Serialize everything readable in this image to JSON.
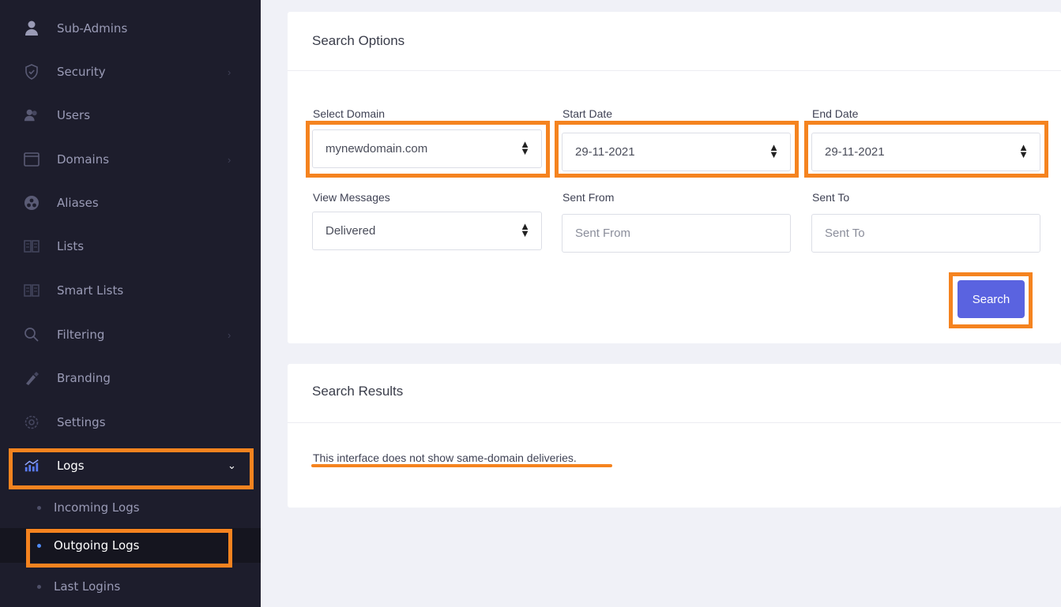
{
  "sidebar": {
    "items": [
      {
        "label": "Sub-Admins",
        "icon": "user-icon"
      },
      {
        "label": "Security",
        "icon": "shield-icon",
        "chevron": "›"
      },
      {
        "label": "Users",
        "icon": "users-icon"
      },
      {
        "label": "Domains",
        "icon": "window-icon",
        "chevron": "›"
      },
      {
        "label": "Aliases",
        "icon": "alias-icon"
      },
      {
        "label": "Lists",
        "icon": "book-icon"
      },
      {
        "label": "Smart Lists",
        "icon": "book-icon"
      },
      {
        "label": "Filtering",
        "icon": "search-icon",
        "chevron": "›"
      },
      {
        "label": "Branding",
        "icon": "brush-icon"
      },
      {
        "label": "Settings",
        "icon": "gear-icon"
      },
      {
        "label": "Logs",
        "icon": "chart-icon",
        "chevron": "⌄"
      }
    ],
    "sub_items": [
      {
        "label": "Incoming Logs"
      },
      {
        "label": "Outgoing Logs"
      },
      {
        "label": "Last Logins"
      }
    ]
  },
  "search_options": {
    "title": "Search Options",
    "select_domain_label": "Select Domain",
    "select_domain_value": "mynewdomain.com",
    "start_date_label": "Start Date",
    "start_date_value": "29-11-2021",
    "end_date_label": "End Date",
    "end_date_value": "29-11-2021",
    "view_messages_label": "View Messages",
    "view_messages_value": "Delivered",
    "sent_from_label": "Sent From",
    "sent_from_placeholder": "Sent From",
    "sent_to_label": "Sent To",
    "sent_to_placeholder": "Sent To",
    "search_button": "Search"
  },
  "search_results": {
    "title": "Search Results",
    "note": "This interface does not show same-domain deliveries."
  },
  "colors": {
    "sidebar_bg": "#1d1d2c",
    "accent": "#5a63e0",
    "highlight": "#f5831f"
  }
}
